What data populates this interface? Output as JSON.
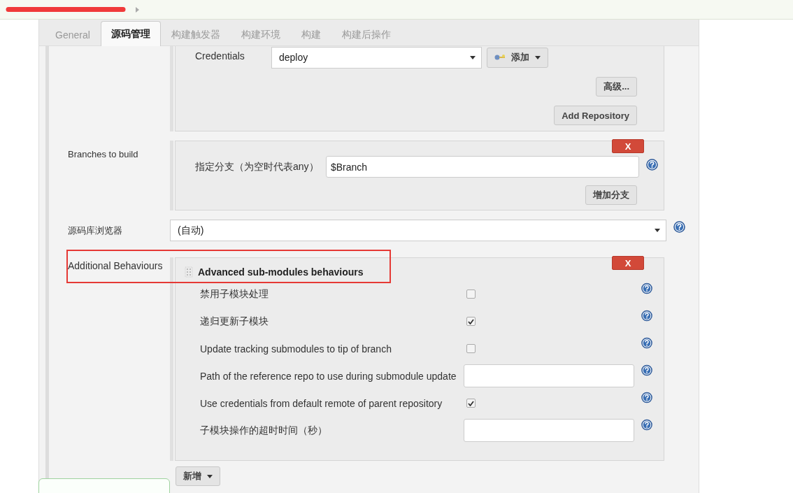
{
  "tabs": [
    {
      "label": "General",
      "selected": false
    },
    {
      "label": "源码管理",
      "selected": true
    },
    {
      "label": "构建触发器",
      "selected": false
    },
    {
      "label": "构建环境",
      "selected": false
    },
    {
      "label": "构建",
      "selected": false
    },
    {
      "label": "构建后操作",
      "selected": false
    }
  ],
  "repository": {
    "credentials_label": "Credentials",
    "credentials_value": "deploy",
    "add_button": "添加",
    "advanced_button": "高级...",
    "add_repository_button": "Add Repository"
  },
  "branches": {
    "label": "Branches to build",
    "delete_button": "X",
    "field_label": "指定分支（为空时代表any）",
    "value": "$Branch",
    "add_branch_button": "增加分支"
  },
  "browser": {
    "label": "源码库浏览器",
    "value": "(自动)"
  },
  "behaviours": {
    "label": "Additional Behaviours",
    "title": "Advanced sub-modules behaviours",
    "delete_button": "X",
    "add_button": "新增",
    "options": [
      {
        "kind": "checkbox",
        "label": "禁用子模块处理",
        "checked": false
      },
      {
        "kind": "checkbox",
        "label": "递归更新子模块",
        "checked": true
      },
      {
        "kind": "checkbox",
        "label": "Update tracking submodules to tip of branch",
        "checked": false
      },
      {
        "kind": "text",
        "label": "Path of the reference repo to use during submodule update"
      },
      {
        "kind": "checkbox",
        "label": "Use credentials from default remote of parent repository",
        "checked": true
      },
      {
        "kind": "text",
        "label": "子模块操作的超时时间（秒）"
      }
    ]
  }
}
